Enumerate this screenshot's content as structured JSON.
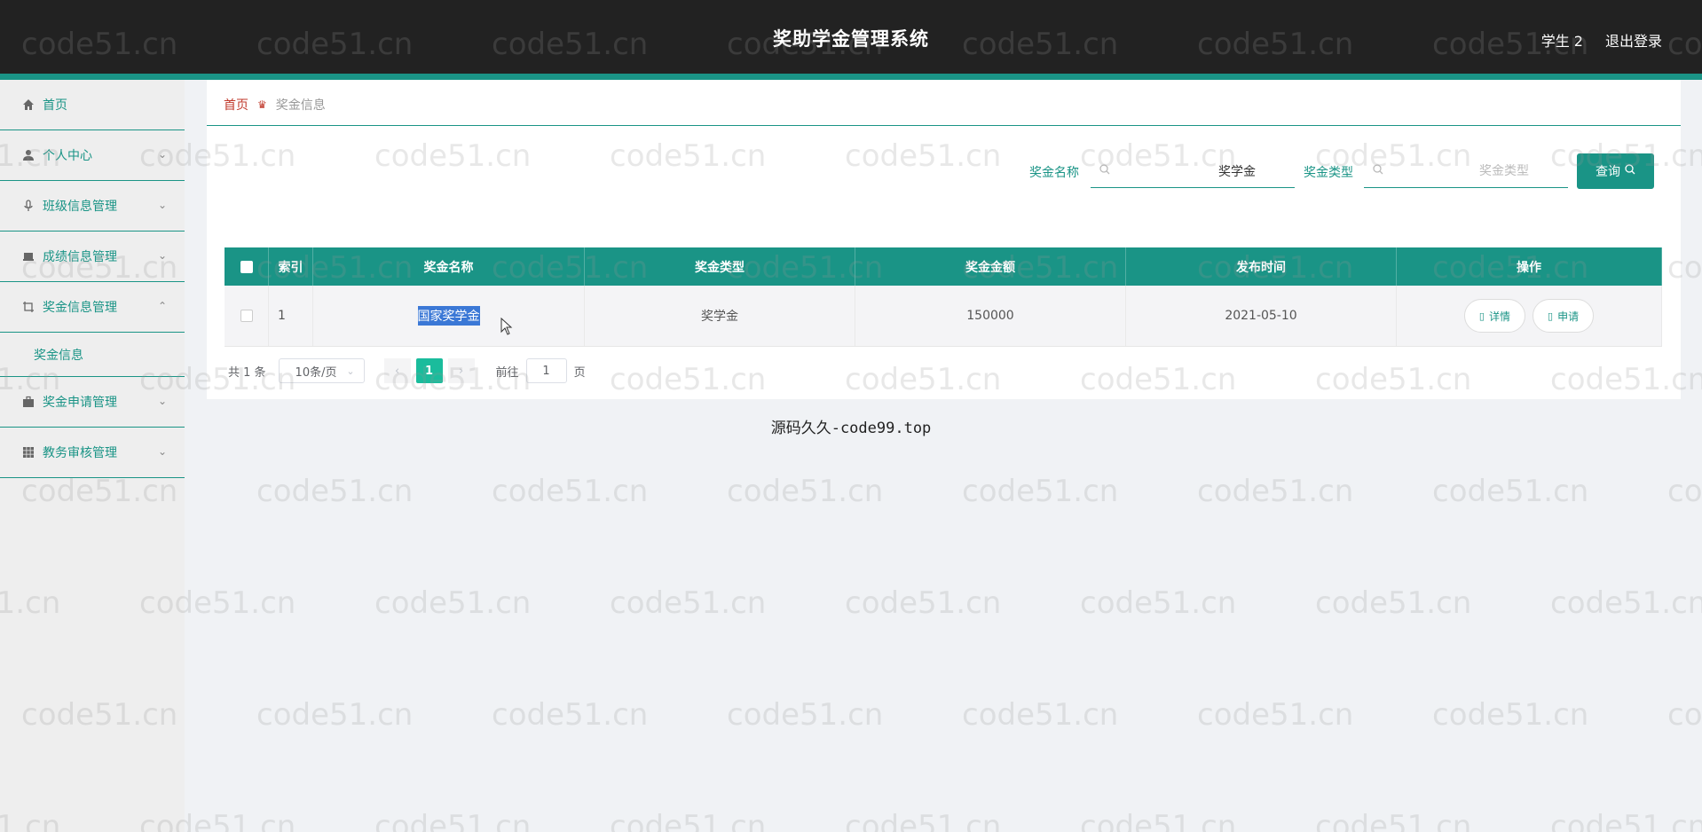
{
  "header": {
    "title": "奖助学金管理系统",
    "user": "学生 2",
    "logout": "退出登录"
  },
  "sidebar": {
    "items": [
      {
        "label": "首页",
        "icon": "home-icon"
      },
      {
        "label": "个人中心",
        "icon": "user-icon"
      },
      {
        "label": "班级信息管理",
        "icon": "mic-icon"
      },
      {
        "label": "成绩信息管理",
        "icon": "laptop-icon"
      },
      {
        "label": "奖金信息管理",
        "icon": "crop-icon"
      },
      {
        "label": "奖金申请管理",
        "icon": "briefcase-icon"
      },
      {
        "label": "教务审核管理",
        "icon": "grid-icon"
      }
    ],
    "submenu": {
      "label": "奖金信息"
    }
  },
  "breadcrumb": {
    "home": "首页",
    "current": "奖金信息"
  },
  "search": {
    "name_label": "奖金名称",
    "name_value": "奖学金",
    "type_label": "奖金类型",
    "type_placeholder": "奖金类型",
    "query_label": "查询"
  },
  "table": {
    "headers": [
      "索引",
      "奖金名称",
      "奖金类型",
      "奖金金额",
      "发布时间",
      "操作"
    ],
    "rows": [
      {
        "index": "1",
        "name": "国家奖学金",
        "type": "奖学金",
        "amount": "150000",
        "date": "2021-05-10",
        "detail": "详情",
        "apply": "申请"
      }
    ]
  },
  "pagination": {
    "total": "共 1 条",
    "page_size": "10条/页",
    "current": "1",
    "goto_label": "前往",
    "goto_value": "1",
    "page_unit": "页"
  },
  "footer_note": "源码久久-code99.top",
  "watermark": "code51.cn",
  "colors": {
    "accent": "#1a9486",
    "header": "#222222",
    "page_active": "#1abc9c"
  }
}
